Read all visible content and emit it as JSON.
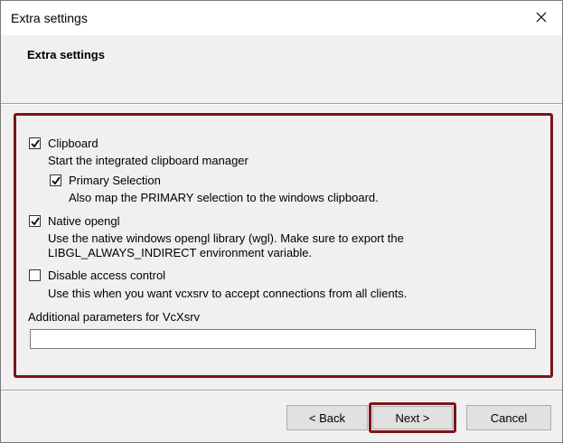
{
  "window": {
    "title": "Extra settings",
    "close_icon": "close-icon"
  },
  "header": {
    "title": "Extra settings"
  },
  "options": [
    {
      "label": "Clipboard",
      "checked": true,
      "description": "Start the integrated clipboard manager"
    },
    {
      "label": "Primary Selection",
      "checked": true,
      "description": "Also map the PRIMARY selection to the windows clipboard."
    },
    {
      "label": "Native opengl",
      "checked": true,
      "description_line1": "Use the native windows opengl library (wgl). Make sure to export the",
      "description_line2": "LIBGL_ALWAYS_INDIRECT environment variable."
    },
    {
      "label": "Disable access control",
      "checked": false,
      "description": "Use this when you want vcxsrv to accept connections from all clients."
    }
  ],
  "params": {
    "label": "Additional parameters for VcXsrv",
    "value": "",
    "placeholder": ""
  },
  "buttons": {
    "back": "< Back",
    "next": "Next >",
    "cancel": "Cancel"
  },
  "colors": {
    "highlight": "#7b1518"
  }
}
